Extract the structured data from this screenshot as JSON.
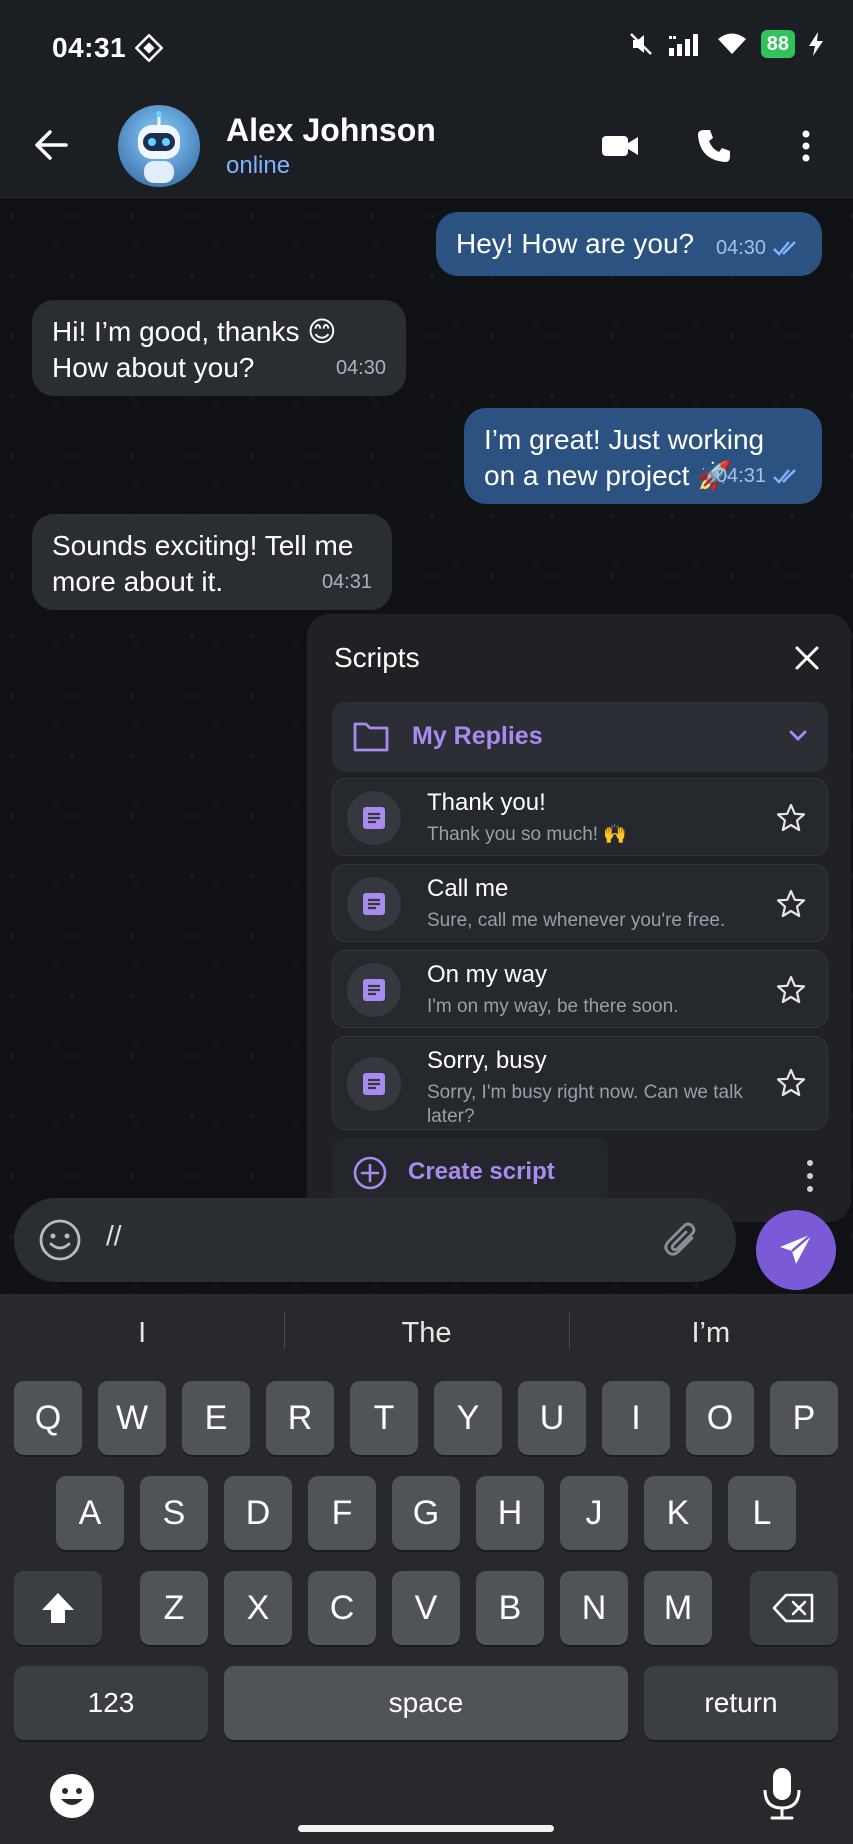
{
  "status_bar": {
    "time": "04:31",
    "battery": "88"
  },
  "header": {
    "contact_name": "Alex Johnson",
    "contact_status": "online"
  },
  "messages": [
    {
      "direction": "out",
      "text": "Hey! How are you?",
      "time": "04:30"
    },
    {
      "direction": "in",
      "line1": "Hi! I’m good, thanks 😊",
      "line2": "How about you?",
      "time": "04:30"
    },
    {
      "direction": "out",
      "line1": "I’m great! Just working",
      "line2": "on a new project 🚀",
      "time": "04:31"
    },
    {
      "direction": "in",
      "line1": "Sounds exciting! Tell me",
      "line2": "more about it.",
      "time": "04:31"
    }
  ],
  "scripts_panel": {
    "title": "Scripts",
    "folder": "My Replies",
    "items": [
      {
        "title": "Thank you!",
        "text": "Thank you so much! 🙌"
      },
      {
        "title": "Call me",
        "text": "Sure, call me whenever you're free."
      },
      {
        "title": "On my way",
        "text": "I'm on my way, be there soon."
      },
      {
        "title": "Sorry, busy",
        "text": "Sorry, I'm busy right now. Can we talk later?"
      }
    ],
    "create_label": "Create script"
  },
  "composer": {
    "value": "//"
  },
  "keyboard": {
    "suggestions": [
      "I",
      "The",
      "I’m"
    ],
    "row1": [
      "Q",
      "W",
      "E",
      "R",
      "T",
      "Y",
      "U",
      "I",
      "O",
      "P"
    ],
    "row2": [
      "A",
      "S",
      "D",
      "F",
      "G",
      "H",
      "J",
      "K",
      "L"
    ],
    "row3": [
      "Z",
      "X",
      "C",
      "V",
      "B",
      "N",
      "M"
    ],
    "numbers_key": "123",
    "space_key": "space",
    "return_key": "return"
  },
  "colors": {
    "accent": "#7a5ad6",
    "outgoing_bubble": "#2b5281",
    "incoming_bubble": "#2a2d31",
    "link": "#a98bf0"
  }
}
